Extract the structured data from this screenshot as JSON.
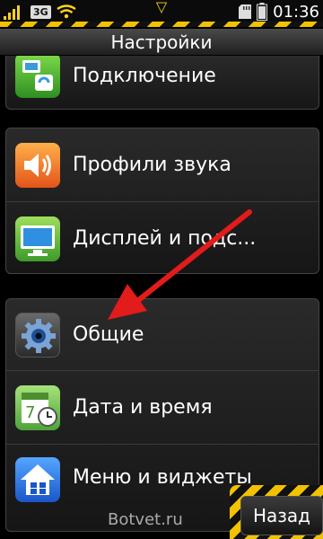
{
  "status_bar": {
    "network": "3G",
    "time": "01:36",
    "icons": [
      "signal-icon",
      "network-3g-icon",
      "wifi-icon",
      "notification-triangle-icon",
      "sd-card-icon",
      "battery-icon"
    ]
  },
  "header": {
    "title": "Настройки"
  },
  "groups": [
    {
      "items": [
        {
          "label": "Подключение",
          "icon": "connection-icon"
        }
      ]
    },
    {
      "items": [
        {
          "label": "Профили звука",
          "icon": "speaker-icon"
        },
        {
          "label": "Дисплей и подс...",
          "icon": "display-icon"
        }
      ]
    },
    {
      "items": [
        {
          "label": "Общие",
          "icon": "gear-icon"
        },
        {
          "label": "Дата и время",
          "icon": "calendar-clock-icon"
        },
        {
          "label": "Меню и виджеты",
          "icon": "home-icon"
        }
      ]
    }
  ],
  "footer": {
    "back_label": "Назад",
    "watermark": "Botvet.ru"
  },
  "colors": {
    "accent": "#f2c200",
    "annotation_arrow": "#e21b1b"
  }
}
